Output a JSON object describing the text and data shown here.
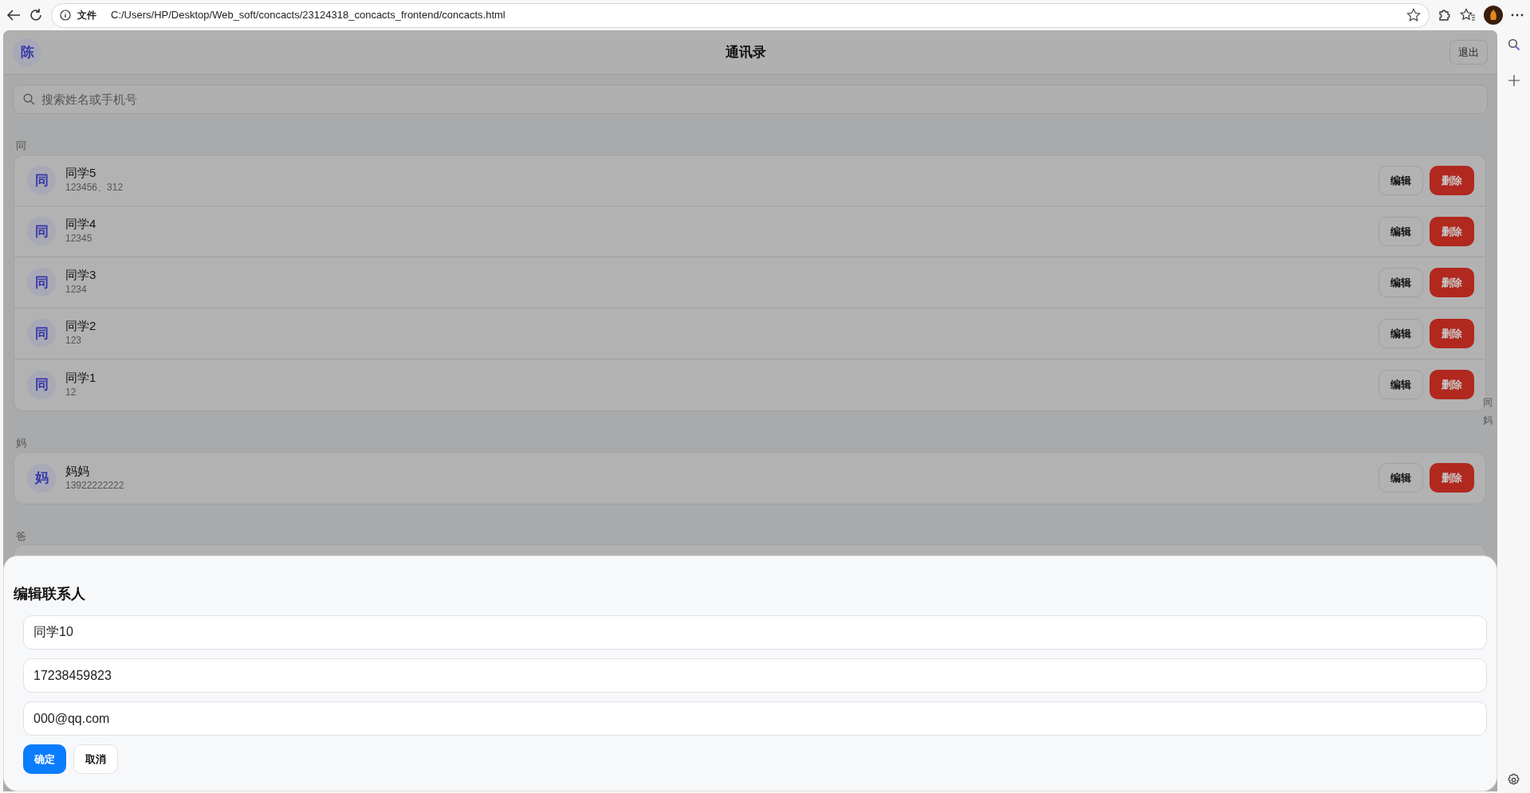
{
  "browser": {
    "scheme_label": "文件",
    "url": "C:/Users/HP/Desktop/Web_soft/concacts/23124318_concacts_frontend/concacts.html"
  },
  "app": {
    "avatar": "陈",
    "title": "通讯录",
    "logout": "退出",
    "search": {
      "placeholder": "搜索姓名或手机号"
    },
    "groups": [
      {
        "letter": "同",
        "contacts": [
          {
            "initial": "同",
            "name": "同学5",
            "phone": "123456、312",
            "edit": "编辑",
            "delete": "删除"
          },
          {
            "initial": "同",
            "name": "同学4",
            "phone": "12345",
            "edit": "编辑",
            "delete": "删除"
          },
          {
            "initial": "同",
            "name": "同学3",
            "phone": "1234",
            "edit": "编辑",
            "delete": "删除"
          },
          {
            "initial": "同",
            "name": "同学2",
            "phone": "123",
            "edit": "编辑",
            "delete": "删除"
          },
          {
            "initial": "同",
            "name": "同学1",
            "phone": "12",
            "edit": "编辑",
            "delete": "删除"
          }
        ]
      },
      {
        "letter": "妈",
        "contacts": [
          {
            "initial": "妈",
            "name": "妈妈",
            "phone": "13922222222",
            "edit": "编辑",
            "delete": "删除"
          }
        ]
      },
      {
        "letter": "爸"
      }
    ],
    "index_bar": [
      "同",
      "妈"
    ]
  },
  "modal": {
    "title": "编辑联系人",
    "fields": [
      {
        "value": "同学10"
      },
      {
        "value": "17238459823"
      },
      {
        "value": "000@qq.com"
      }
    ],
    "buttons": [
      {
        "label": "确定",
        "kind": "primary"
      },
      {
        "label": "取消",
        "kind": "secondary"
      }
    ]
  }
}
